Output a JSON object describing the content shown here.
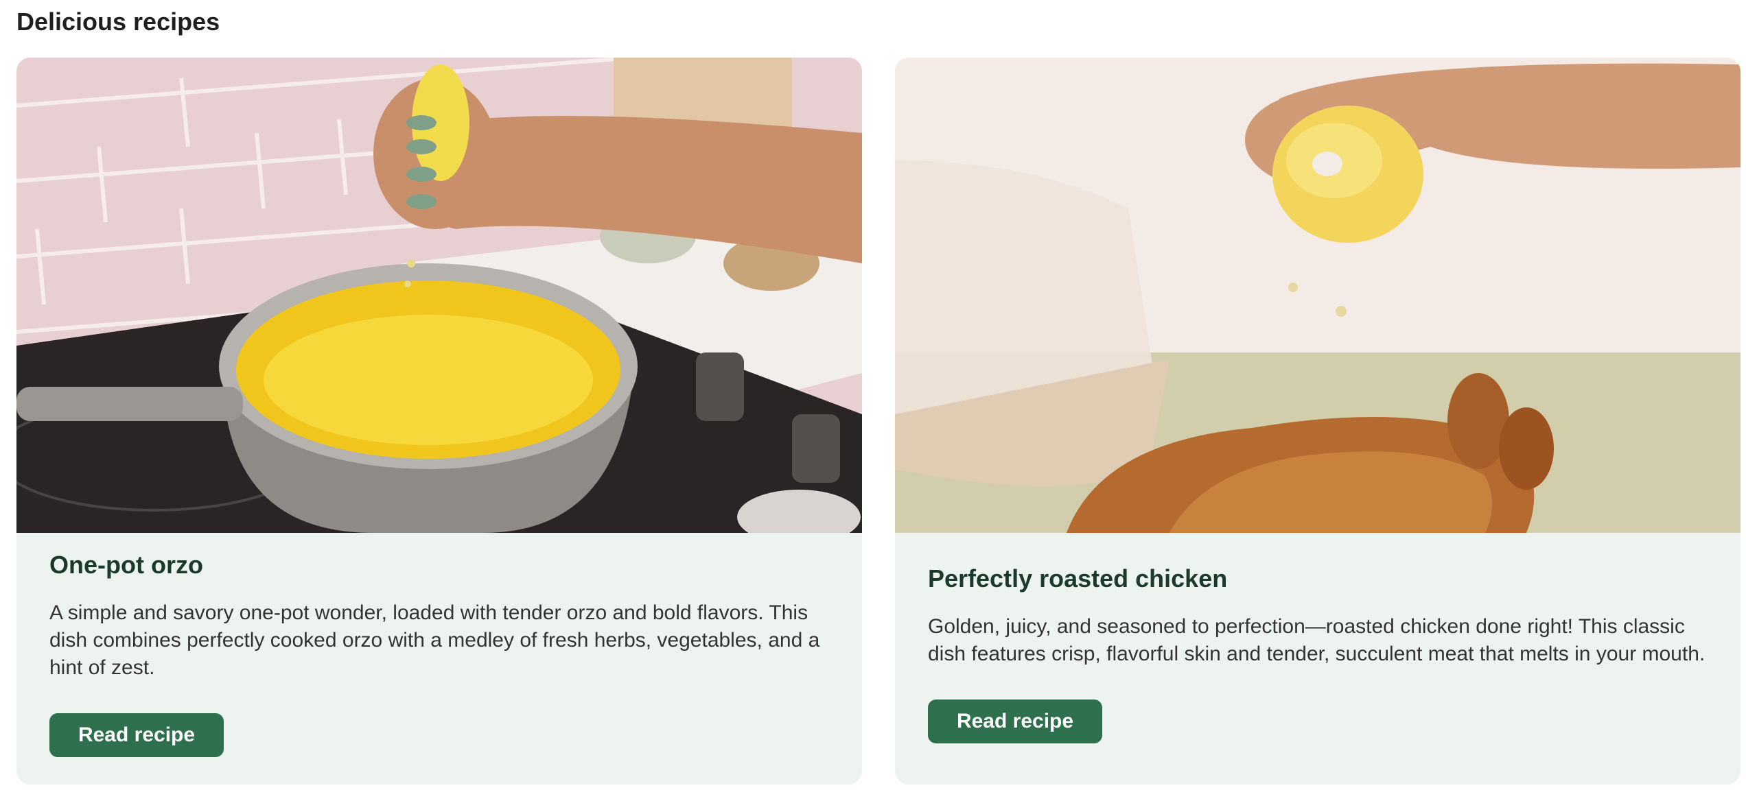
{
  "page": {
    "title": "Delicious recipes"
  },
  "colors": {
    "card_background": "#edf4f0",
    "button_background": "#2e6f4e",
    "button_text": "#ffffff",
    "title_text": "#1b3a2c"
  },
  "recipes": [
    {
      "title": "One-pot orzo",
      "description": "A simple and savory one-pot wonder, loaded with tender orzo and bold flavors. This dish combines perfectly cooked orzo with a medley of fresh herbs, vegetables, and a hint of zest.",
      "button_label": "Read recipe",
      "image_icon": "orzo-pot-photo"
    },
    {
      "title": "Perfectly roasted chicken",
      "description": "Golden, juicy, and seasoned to perfection—roasted chicken done right! This classic dish features crisp, flavorful skin and tender, succulent meat that melts in your mouth.",
      "button_label": "Read recipe",
      "image_icon": "roasted-chicken-photo"
    }
  ]
}
